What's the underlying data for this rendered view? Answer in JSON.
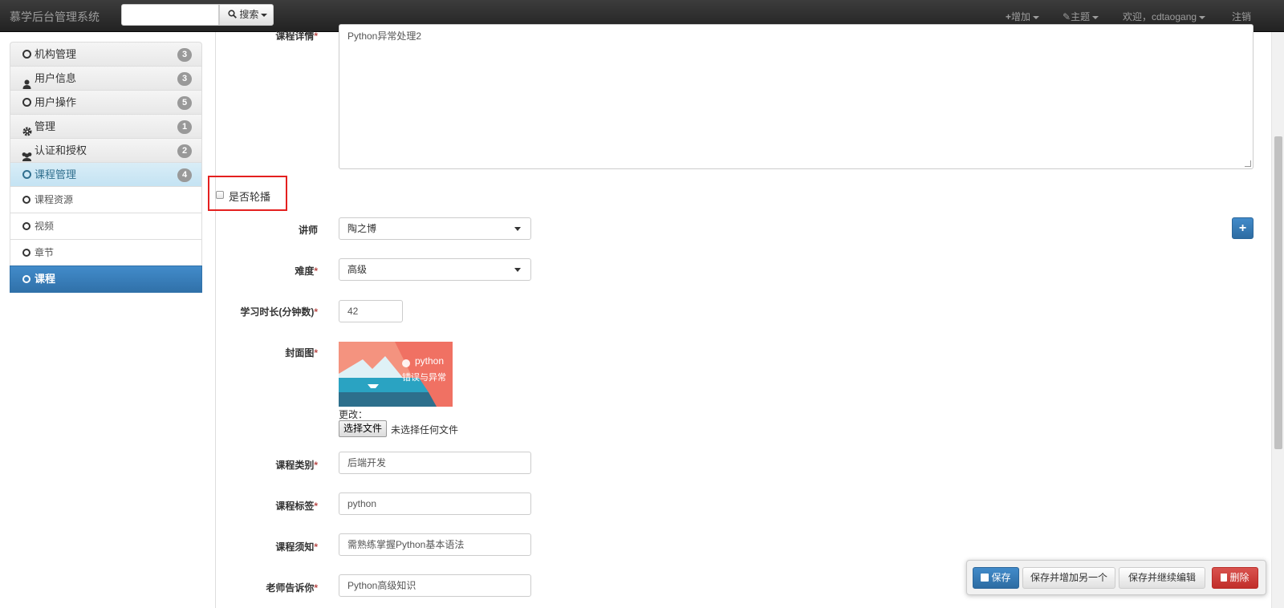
{
  "navbar": {
    "brand": "慕学后台管理系统",
    "search_value": "",
    "search_label": "搜索",
    "add_label": "增加",
    "theme_label": "主题",
    "welcome_label": "欢迎，cdtaogang",
    "logout_label": "注销"
  },
  "sidebar": {
    "groups": [
      {
        "label": "机构管理",
        "badge": "3",
        "icon": "circle-icon"
      },
      {
        "label": "用户信息",
        "badge": "3",
        "icon": "user-icon"
      },
      {
        "label": "用户操作",
        "badge": "5",
        "icon": "circle-icon"
      },
      {
        "label": "管理",
        "badge": "1",
        "icon": "gear-icon"
      },
      {
        "label": "认证和授权",
        "badge": "2",
        "icon": "users-icon"
      },
      {
        "label": "课程管理",
        "badge": "4",
        "icon": "circle-icon"
      }
    ],
    "sub_items": [
      {
        "label": "课程资源"
      },
      {
        "label": "视频"
      },
      {
        "label": "章节"
      },
      {
        "label": "课程"
      }
    ]
  },
  "form": {
    "detail_label": "课程详情",
    "detail_value": "Python异常处理2",
    "is_banner_label": "是否轮播",
    "is_banner_checked": false,
    "teacher_label": "讲师",
    "teacher_value": "陶之博",
    "degree_label": "难度",
    "degree_value": "高级",
    "learn_time_label": "学习时长(分钟数)",
    "learn_time_value": "42",
    "cover_label": "封面图",
    "cover_image": {
      "title": "python",
      "subtitle": "错误与异常"
    },
    "change_label": "更改：",
    "file_button": "选择文件",
    "file_status": "未选择任何文件",
    "category_label": "课程类别",
    "category_value": "后端开发",
    "tag_label": "课程标签",
    "tag_value": "python",
    "notice_label": "课程须知",
    "notice_value": "需熟练掌握Python基本语法",
    "teacher_tell_label": "老师告诉你",
    "teacher_tell_value": "Python高级知识",
    "required_mark": "*"
  },
  "actions": {
    "save": "保存",
    "save_add": "保存并增加另一个",
    "save_continue": "保存并继续编辑",
    "delete": "删除"
  },
  "colors": {
    "primary": "#428bca",
    "danger": "#d9534f",
    "highlight": "#e4201f",
    "navbar": "#222222"
  }
}
